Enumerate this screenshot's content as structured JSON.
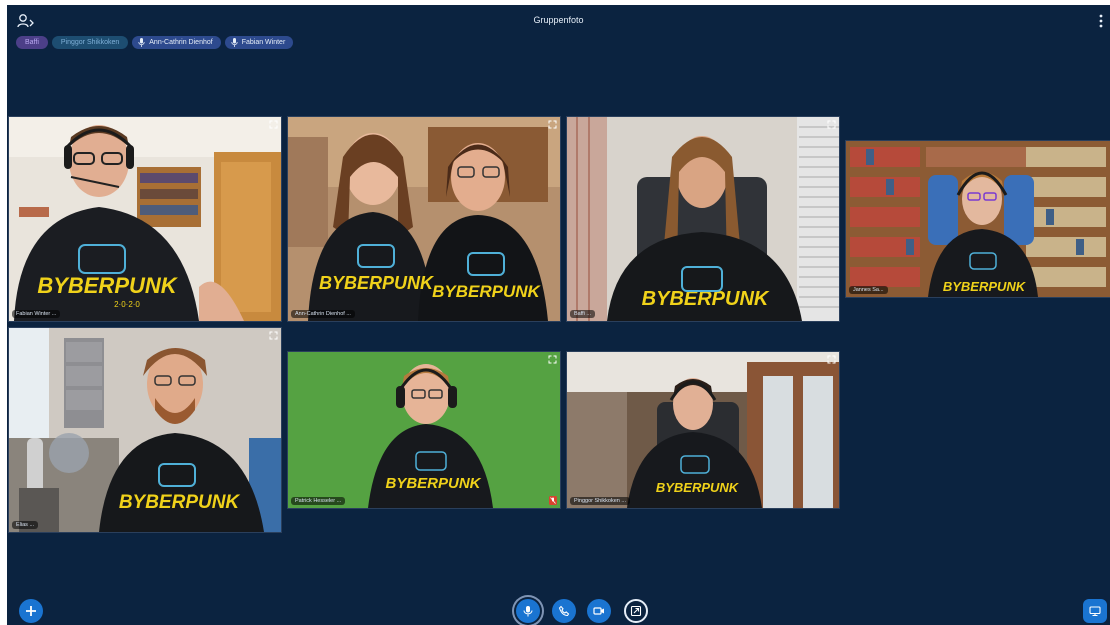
{
  "window": {
    "title": "Gruppenfoto"
  },
  "icons": {
    "participants": "participants-icon",
    "more": "more-vertical-icon",
    "mic": "microphone-icon",
    "expand": "expand-icon",
    "muted": "mic-muted-icon",
    "add": "plus-icon",
    "call": "phone-icon",
    "video": "video-camera-icon",
    "screen": "screen-share-icon",
    "share": "share-screen-icon"
  },
  "participants_bar": [
    {
      "label": "Baffi",
      "style": "purple"
    },
    {
      "label": "Pinggor Shikkoken",
      "style": "teal"
    },
    {
      "label": "Ann-Cathrin Dienhof",
      "style": "blue"
    },
    {
      "label": "Fabian Winter",
      "style": "blue"
    }
  ],
  "tiles": [
    {
      "name": "Fabian Winter ..."
    },
    {
      "name": "Ann-Cathrin Dienhof ..."
    },
    {
      "name": "Baffi ..."
    },
    {
      "name": "Jannes Sa..."
    },
    {
      "name": "Elias ..."
    },
    {
      "name": "Patrick Hesseler ..."
    },
    {
      "name": "Pinggor Shikkoken ..."
    }
  ],
  "shirt_text": {
    "main": "BYBERPUNK",
    "sub": "2·0·2·0"
  },
  "colors": {
    "background": "#0b2340",
    "accent": "#1a74d1",
    "shirt_text": "#f0d21a"
  }
}
